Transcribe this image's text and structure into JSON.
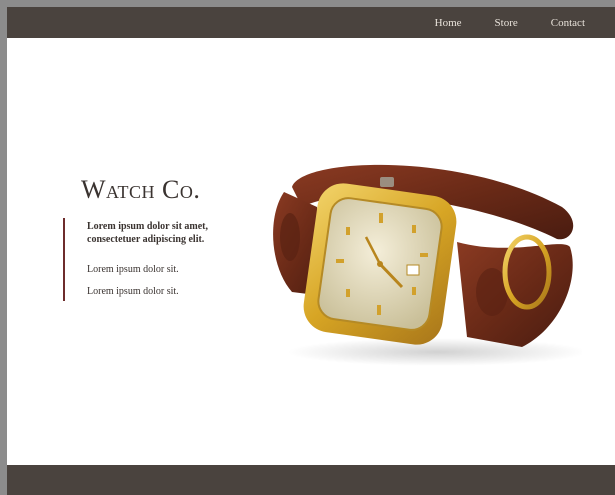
{
  "nav": {
    "home": "Home",
    "store": "Store",
    "contact": "Contact"
  },
  "hero": {
    "brand": "Watch Co.",
    "lead": "Lorem ipsum dolor sit amet, consectetuer adipiscing elit.",
    "items": [
      "Lorem ipsum dolor sit.",
      "Lorem ipsum dolor sit."
    ]
  },
  "image": {
    "subject": "watch-with-leather-strap"
  },
  "colors": {
    "bar": "#4a433e",
    "accent": "#6e2c2c",
    "text": "#3a3330"
  }
}
